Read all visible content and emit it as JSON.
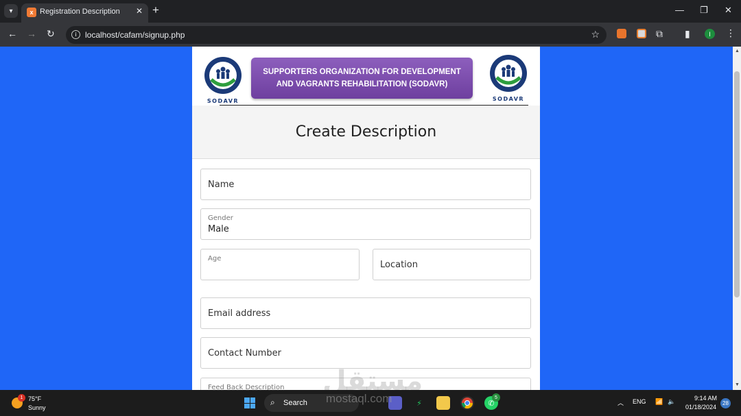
{
  "browser": {
    "tab_title": "Registration Description",
    "url": "localhost/cafam/signup.php",
    "profile_initial": "I"
  },
  "banner": {
    "organization_name": "SUPPORTERS ORGANIZATION FOR DEVELOPMENT AND VAGRANTS REHABILITATION (SODAVR)",
    "logo_text": "SODAVR"
  },
  "form": {
    "title": "Create Description",
    "fields": {
      "name": {
        "label": "Name"
      },
      "gender": {
        "label": "Gender",
        "value": "Male"
      },
      "age": {
        "label": "Age",
        "value": ""
      },
      "location": {
        "label": "Location"
      },
      "email": {
        "label": "Email address"
      },
      "contact": {
        "label": "Contact Number"
      },
      "feedback": {
        "label": "Feed Back Description"
      }
    }
  },
  "taskbar": {
    "weather_temp": "75°F",
    "weather_desc": "Sunny",
    "weather_badge": "1",
    "search_label": "Search",
    "whatsapp_badge": "5",
    "language": "ENG",
    "time": "9:14 AM",
    "date": "01/18/2024",
    "notification_count": "28"
  },
  "watermark": {
    "arabic": "مستقل",
    "latin": "mostaql.com"
  },
  "colors": {
    "page_background": "#1f66f7",
    "banner_purple": "#7a4aab",
    "chrome_dark": "#202124"
  }
}
